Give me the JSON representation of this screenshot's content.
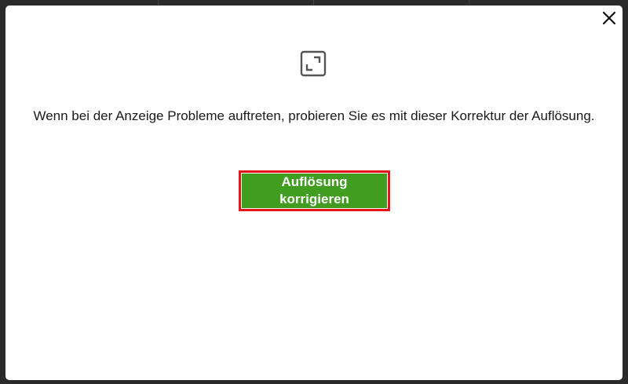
{
  "dialog": {
    "message": "Wenn bei der Anzeige Probleme auftreten, probieren Sie es mit dieser Korrektur der Auflösung.",
    "fix_button_label": "Auflösung korrigieren",
    "close_icon": "close-icon",
    "resize_icon": "expand-icon"
  },
  "colors": {
    "button_bg": "#409d20",
    "button_highlight_border": "#e8141c",
    "dialog_bg": "#ffffff",
    "backdrop": "#2a2a2a"
  }
}
